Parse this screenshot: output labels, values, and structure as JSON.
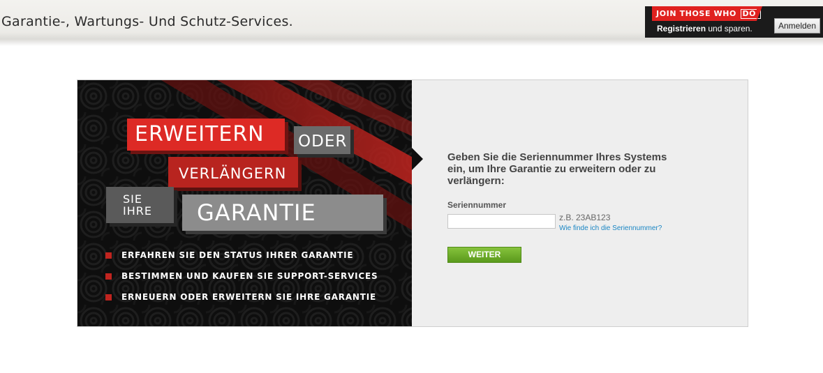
{
  "header": {
    "title": "Garantie-, Wartungs- Und Schutz-Services."
  },
  "promo": {
    "badge_text": "JOIN THOSE WHO",
    "badge_do": "DO.",
    "register_bold": "Registrieren",
    "register_rest": " und sparen.",
    "login_label": "Anmelden",
    "accent_color": "#e0211f"
  },
  "banner": {
    "erweitern": "ERWEITERN",
    "oder": "ODER",
    "verlaengern": "VERLÄNGERN",
    "sie": "SIE",
    "ihre": "IHRE",
    "garantie": "GARANTIE",
    "bullets": [
      "ERFAHREN SIE DEN STATUS IHRER GARANTIE",
      "BESTIMMEN UND KAUFEN SIE SUPPORT-SERVICES",
      "ERNEUERN ODER ERWEITERN SIE IHRE GARANTIE"
    ],
    "accent_color": "#dd2a25"
  },
  "form": {
    "heading": "Geben Sie die Seriennummer Ihres Systems ein, um Ihre Garantie zu erweitern oder zu verlängern:",
    "serial_label": "Seriennummer",
    "serial_value": "",
    "example": "z.B. 23AB123",
    "help_link": "Wie finde ich die Seriennummer?",
    "submit_label": "WEITER",
    "submit_color": "#6aab28"
  }
}
